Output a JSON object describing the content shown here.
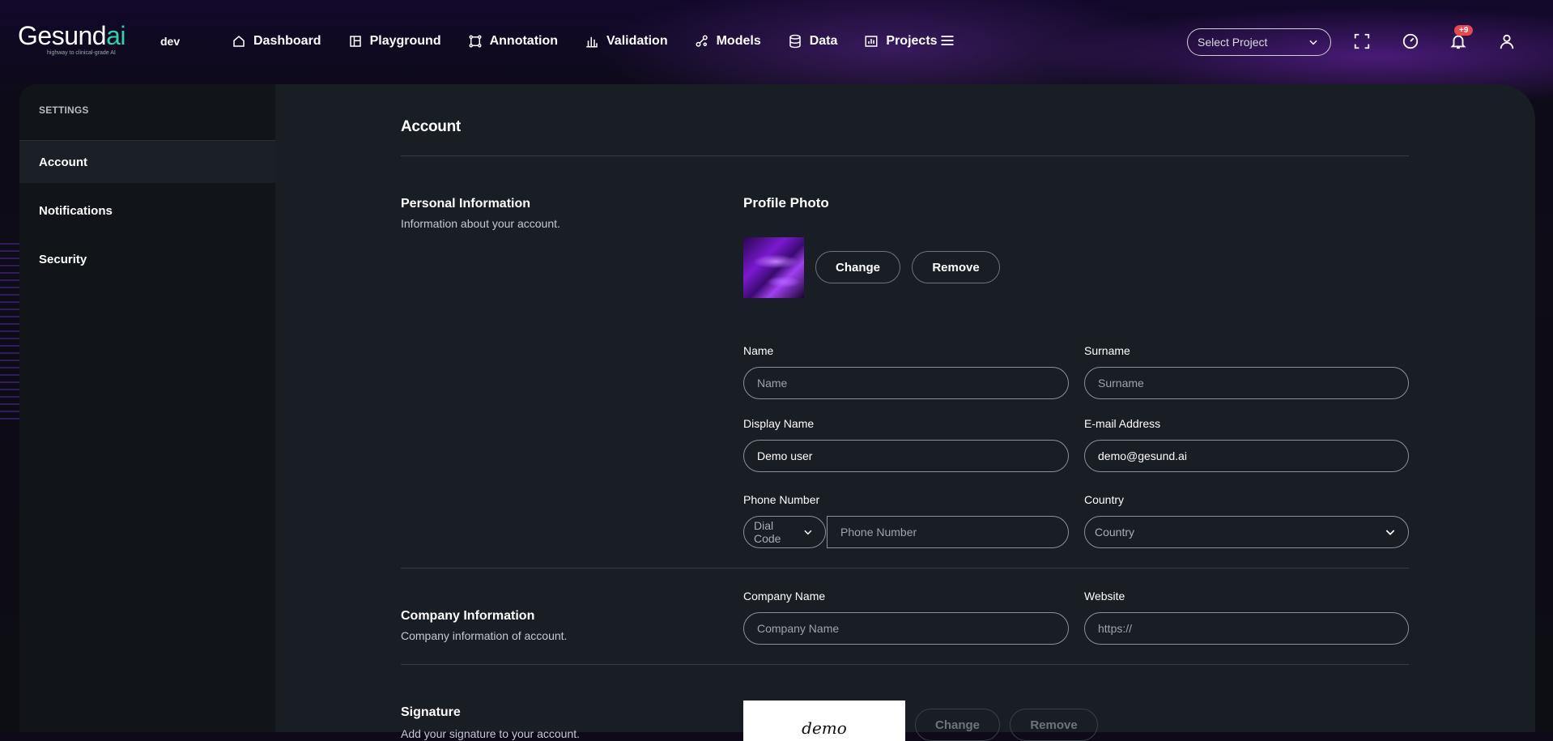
{
  "app": {
    "logo_text_main": "Gesund",
    "logo_text_ai": "ai",
    "logo_tagline": "highway to clinical-grade AI",
    "environment": "dev"
  },
  "nav": {
    "items": [
      {
        "label": "Dashboard",
        "icon": "home-icon"
      },
      {
        "label": "Playground",
        "icon": "playground-icon"
      },
      {
        "label": "Annotation",
        "icon": "annotation-icon"
      },
      {
        "label": "Validation",
        "icon": "bar-chart-icon"
      },
      {
        "label": "Models",
        "icon": "models-icon"
      },
      {
        "label": "Data",
        "icon": "database-icon"
      },
      {
        "label": "Projects",
        "icon": "projects-icon"
      }
    ],
    "select_project_placeholder": "Select Project",
    "notification_count": "+9"
  },
  "sidebar": {
    "heading": "SETTINGS",
    "items": [
      {
        "label": "Account",
        "active": true
      },
      {
        "label": "Notifications",
        "active": false
      },
      {
        "label": "Security",
        "active": false
      }
    ]
  },
  "account": {
    "title": "Account",
    "personal": {
      "title": "Personal Information",
      "description": "Information about your account.",
      "profile_photo_label": "Profile Photo",
      "change_label": "Change",
      "remove_label": "Remove",
      "name_label": "Name",
      "name_placeholder": "Name",
      "name_value": "",
      "surname_label": "Surname",
      "surname_placeholder": "Surname",
      "surname_value": "",
      "display_name_label": "Display Name",
      "display_name_value": "Demo user",
      "email_label": "E-mail Address",
      "email_value": "demo@gesund.ai",
      "phone_label": "Phone Number",
      "dial_code_placeholder": "Dial Code",
      "phone_placeholder": "Phone Number",
      "country_label": "Country",
      "country_placeholder": "Country"
    },
    "company": {
      "title": "Company Information",
      "description": "Company information of account.",
      "company_name_label": "Company Name",
      "company_name_placeholder": "Company Name",
      "website_label": "Website",
      "website_placeholder": "https://"
    },
    "signature": {
      "title": "Signature",
      "description": "Add your signature to your account.",
      "signature_text": "demo",
      "change_label": "Change",
      "remove_label": "Remove"
    }
  },
  "colors": {
    "accent": "#2fd3a6",
    "badge": "#e5484d",
    "panel": "#191d24",
    "sidebar": "#111419"
  }
}
